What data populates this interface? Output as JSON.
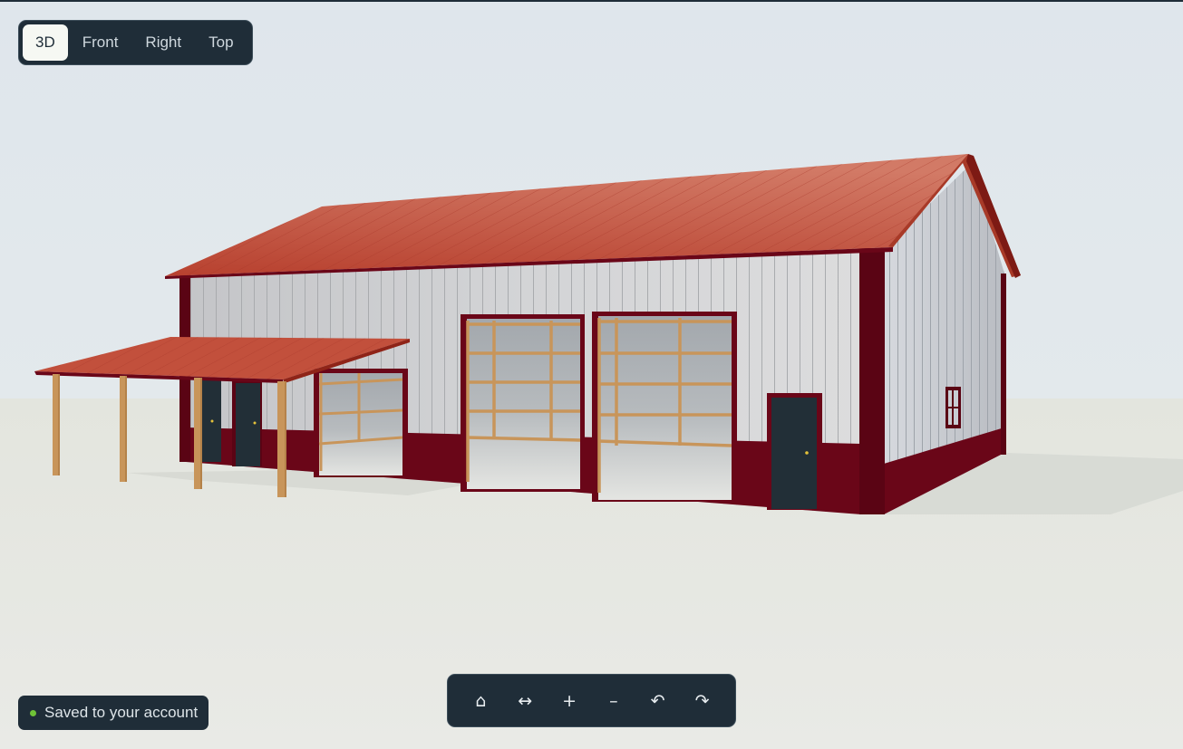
{
  "view_tabs": {
    "items": [
      {
        "label": "3D",
        "active": true
      },
      {
        "label": "Front",
        "active": false
      },
      {
        "label": "Right",
        "active": false
      },
      {
        "label": "Top",
        "active": false
      }
    ]
  },
  "toolbar": {
    "home": {
      "icon": "home-icon",
      "glyph": "⌂"
    },
    "pan": {
      "icon": "pan-horizontal-icon",
      "glyph": "↔"
    },
    "zoom_in": {
      "icon": "zoom-in-icon",
      "glyph": "+"
    },
    "zoom_out": {
      "icon": "zoom-out-icon",
      "glyph": "–"
    },
    "undo": {
      "icon": "undo-icon",
      "glyph": "↶"
    },
    "redo": {
      "icon": "redo-icon",
      "glyph": "↷"
    }
  },
  "status": {
    "text": "Saved to your account",
    "color": "#6fc237"
  },
  "scene": {
    "roof_color": "#c2503c",
    "trim_color": "#6a0618",
    "wall_color": "#c8c9cc",
    "wainscot_color": "#6a0618",
    "door_color": "#222f37",
    "post_color": "#c8955a",
    "sky_color": "#dfe6ec",
    "ground_color": "#e6e7e1"
  }
}
